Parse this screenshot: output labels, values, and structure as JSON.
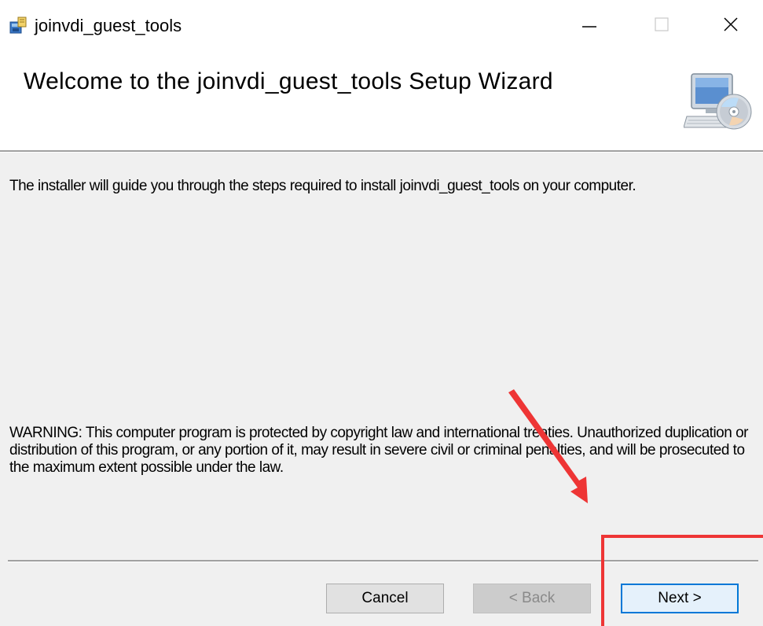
{
  "window": {
    "title": "joinvdi_guest_tools",
    "app_icon": "installer-package-icon",
    "controls": {
      "minimize_icon": "minimize-icon",
      "maximize_icon": "maximize-icon",
      "close_icon": "close-icon"
    }
  },
  "banner": {
    "title": "Welcome to the joinvdi_guest_tools Setup Wizard",
    "graphic_icon": "computer-cd-icon"
  },
  "content": {
    "intro": "The installer will guide you through the steps required to install joinvdi_guest_tools on your computer.",
    "warning": "WARNING: This computer program is protected by copyright law and international treaties. Unauthorized duplication or distribution of this program, or any portion of it, may result in severe civil or criminal penalties, and will be prosecuted to the maximum extent possible under the law."
  },
  "buttons": {
    "cancel": "Cancel",
    "back": "< Back",
    "back_enabled": false,
    "next": "Next >"
  },
  "annotation": {
    "arrow_icon": "red-arrow-annotation",
    "highlight": "red-highlight-box",
    "color": "#ee3535"
  },
  "colors": {
    "accent": "#0078d7",
    "panel_background": "#f0f0f0"
  }
}
